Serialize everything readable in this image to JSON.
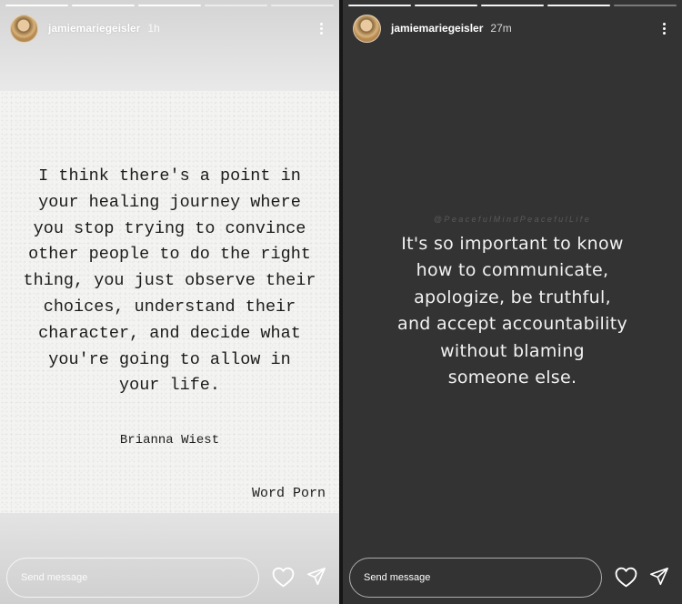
{
  "stories": [
    {
      "username": "jamiemariegeisler",
      "time": "1h",
      "progress": [
        true,
        true,
        true,
        false,
        false
      ],
      "quote_lines": [
        "I think there's a point in",
        "your healing journey where",
        "you stop trying to convince",
        "other people to do the right",
        "thing, you just observe their",
        "choices, understand their",
        "character, and decide what",
        "you're going to allow in",
        "your life."
      ],
      "author": "Brianna Wiest",
      "signature": "Word Porn",
      "send_placeholder": "Send message",
      "icons": {
        "more": "more-vertical-icon",
        "like": "heart-icon",
        "share": "send-icon"
      }
    },
    {
      "username": "jamiemariegeisler",
      "time": "27m",
      "progress": [
        true,
        true,
        true,
        true,
        false
      ],
      "watermark": "@PeacefulMindPeacefulLife",
      "statement_lines": [
        "It's so important to know",
        "how to communicate,",
        "apologize, be truthful,",
        "and accept accountability",
        "without blaming",
        "someone else."
      ],
      "send_placeholder": "Send message",
      "icons": {
        "more": "more-vertical-icon",
        "like": "heart-icon",
        "share": "send-icon"
      }
    }
  ],
  "colors": {
    "dark_story_bg": "#333333",
    "paper": "#f3f3f1",
    "text_dark": "#1b1b1b",
    "text_light": "#f2f2f2"
  }
}
